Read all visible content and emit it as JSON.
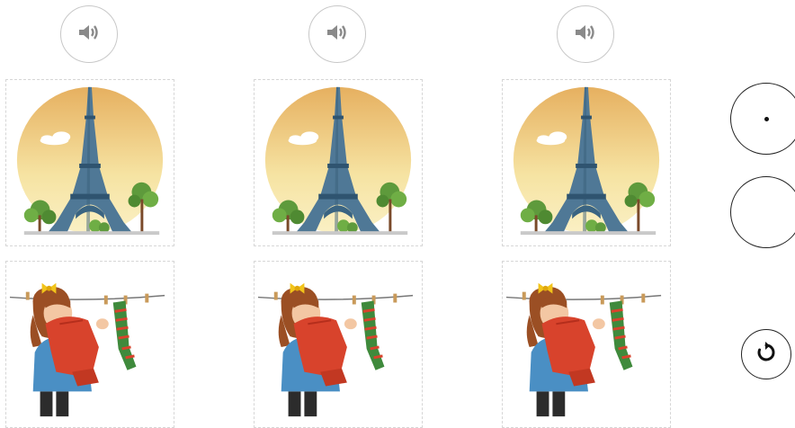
{
  "columns": [
    {
      "audio_icon": "speaker-icon",
      "top_card_image": "eiffel-tower-illustration",
      "bottom_card_image": "girl-with-scarves-on-clothesline-illustration"
    },
    {
      "audio_icon": "speaker-icon",
      "top_card_image": "eiffel-tower-illustration",
      "bottom_card_image": "girl-with-scarves-on-clothesline-illustration"
    },
    {
      "audio_icon": "speaker-icon",
      "top_card_image": "eiffel-tower-illustration",
      "bottom_card_image": "girl-with-scarves-on-clothesline-illustration"
    }
  ],
  "side_controls": {
    "radio_options": [
      {
        "selected": true
      },
      {
        "selected": false
      }
    ],
    "reset_icon": "reset-icon"
  },
  "colors": {
    "sky_top": "#e8b563",
    "sky_bottom": "#f8ecb0",
    "tower": "#4f7896",
    "tree": "#5e9a3c",
    "scarf_red": "#d8432c",
    "scarf_green": "#3f8a3c",
    "shirt_blue": "#4a8fc4",
    "hair": "#9b4f24",
    "bow": "#f2c41a"
  }
}
